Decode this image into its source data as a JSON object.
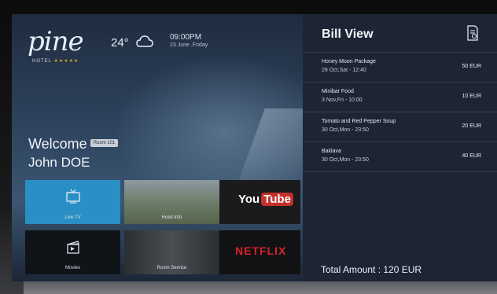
{
  "header": {
    "brand": "pine",
    "brand_sub": "HOTEL",
    "stars": "★★★★★",
    "temperature": "24°",
    "weather_icon": "cloud-icon",
    "time": "09:00PM",
    "date": "23 June ,Friday"
  },
  "welcome": {
    "greeting": "Welcome",
    "room": "Room 101",
    "guest_name": "John DOE"
  },
  "tiles": {
    "live_tv": "Live TV",
    "hotel_info": "Hotel Info",
    "youtube_you": "You",
    "youtube_tube": "Tube",
    "movies": "Movies",
    "room_service": "Room Service",
    "netflix": "NETFLIX"
  },
  "bill": {
    "title": "Bill View",
    "items": [
      {
        "name": "Honey Moon Package",
        "date": "28 Oct,Sat - 12:40",
        "price": "50 EUR"
      },
      {
        "name": "Minibar Food",
        "date": "3 Nov,Fri - 10:00",
        "price": "10 EUR"
      },
      {
        "name": "Tomato and Red Pepper Soup",
        "date": "30 Oct,Mon - 23:50",
        "price": "20 EUR"
      },
      {
        "name": "Baklava",
        "date": "30 Oct,Mon - 23:50",
        "price": "40 EUR"
      }
    ],
    "total": "Total Amount : 120 EUR"
  },
  "colors": {
    "panel_bg": "#1d2433",
    "live_tv_accent": "#2a8fc4",
    "youtube_red": "#c4302b",
    "netflix_red": "#d8222a",
    "stars_gold": "#d2a23a"
  }
}
